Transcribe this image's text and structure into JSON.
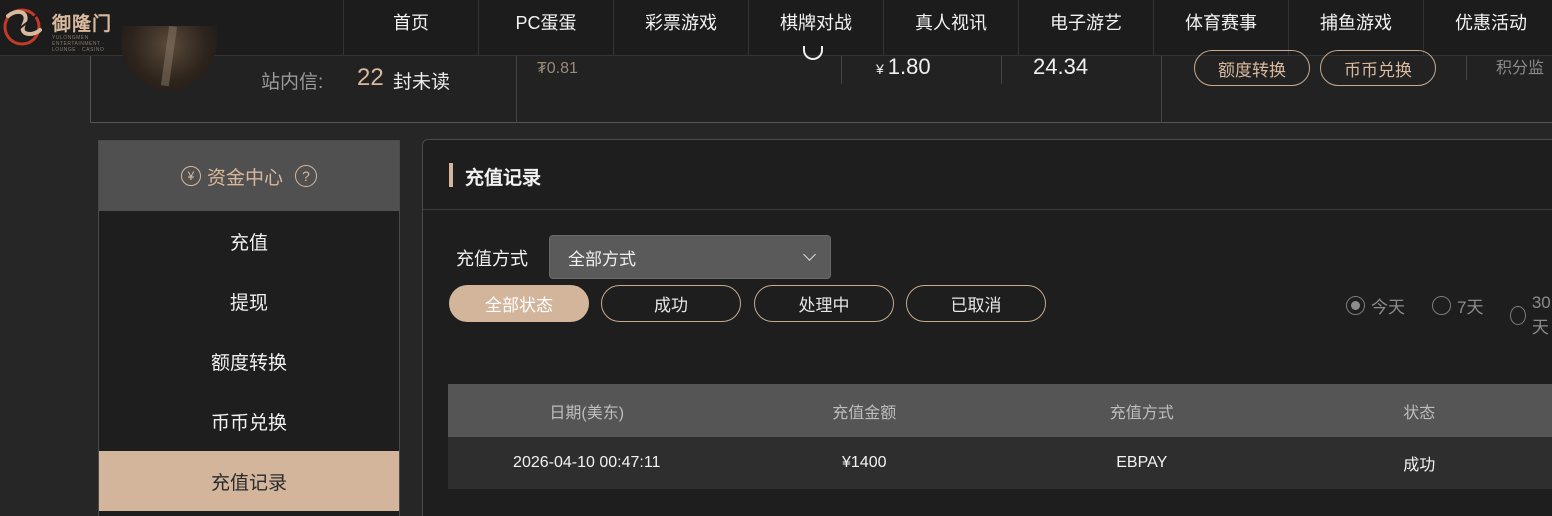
{
  "brand": {
    "name": "御隆门",
    "subtitle": "YULONGMEN ENTERTAINMENT · LOUNGE · CASINO",
    "accent": "#d2b59b"
  },
  "nav": [
    {
      "label": "首页"
    },
    {
      "label": "PC蛋蛋"
    },
    {
      "label": "彩票游戏"
    },
    {
      "label": "棋牌对战"
    },
    {
      "label": "真人视讯"
    },
    {
      "label": "电子游艺"
    },
    {
      "label": "体育赛事"
    },
    {
      "label": "捕鱼游戏"
    },
    {
      "label": "优惠活动"
    }
  ],
  "user": {
    "message_label": "站内信:",
    "message_count": "22",
    "message_unit": "封未读",
    "balance_small": "₮0.81",
    "balance_1_currency": "¥",
    "balance_1": "1.80",
    "balance_2": "24.34",
    "quota_transfer_label": "额度转换",
    "coin_exchange_label": "币币兑换",
    "cut_text": "积分监"
  },
  "sidebar": {
    "title": "资金中心",
    "title_icon": "yen-icon",
    "help_icon": "?",
    "yen_glyph": "¥",
    "items": [
      {
        "label": "充值",
        "active": false
      },
      {
        "label": "提现",
        "active": false
      },
      {
        "label": "额度转换",
        "active": false
      },
      {
        "label": "币币兑换",
        "active": false
      },
      {
        "label": "充值记录",
        "active": true
      }
    ]
  },
  "main": {
    "title": "充值记录",
    "filter_label": "充值方式",
    "filter_value": "全部方式",
    "statuses": [
      {
        "label": "全部状态",
        "active": true
      },
      {
        "label": "成功",
        "active": false
      },
      {
        "label": "处理中",
        "active": false
      },
      {
        "label": "已取消",
        "active": false
      }
    ],
    "ranges": [
      {
        "label": "今天",
        "selected": true
      },
      {
        "label": "7天",
        "selected": false
      },
      {
        "label": "30天",
        "selected": false
      }
    ],
    "table": {
      "headers": [
        "日期(美东)",
        "充值金额",
        "充值方式",
        "状态"
      ],
      "rows": [
        [
          "2026-04-10 00:47:11",
          "¥1400",
          "EBPAY",
          "成功"
        ]
      ]
    }
  }
}
